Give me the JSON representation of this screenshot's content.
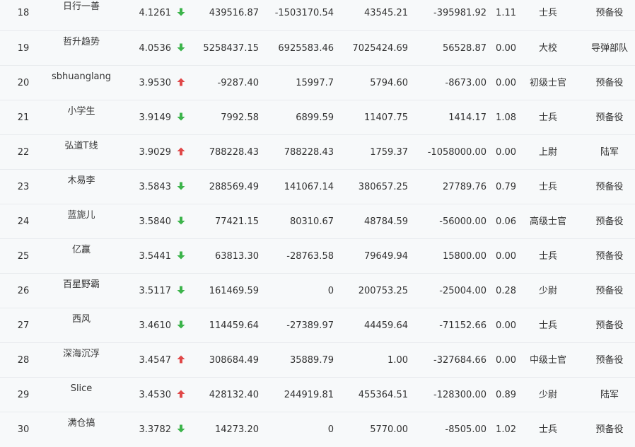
{
  "colors": {
    "up_arrow": "#e04848",
    "down_arrow": "#3cb44b",
    "text": "#333333",
    "background": "#f7f9fa"
  },
  "rows": [
    {
      "rank": "18",
      "name": "日行一善",
      "score": "4.1261",
      "trend": "down",
      "v1": "439516.87",
      "v2": "-1503170.54",
      "v3": "43545.21",
      "v4": "-395981.92",
      "ratio": "1.11",
      "military_rank": "士兵",
      "branch": "预备役"
    },
    {
      "rank": "19",
      "name": "哲升趋势",
      "score": "4.0536",
      "trend": "down",
      "v1": "5258437.15",
      "v2": "6925583.46",
      "v3": "7025424.69",
      "v4": "56528.87",
      "ratio": "0.00",
      "military_rank": "大校",
      "branch": "导弹部队"
    },
    {
      "rank": "20",
      "name": "sbhuanglang",
      "score": "3.9530",
      "trend": "up",
      "v1": "-9287.40",
      "v2": "15997.7",
      "v3": "5794.60",
      "v4": "-8673.00",
      "ratio": "0.00",
      "military_rank": "初级士官",
      "branch": "预备役"
    },
    {
      "rank": "21",
      "name": "小学生",
      "score": "3.9149",
      "trend": "down",
      "v1": "7992.58",
      "v2": "6899.59",
      "v3": "11407.75",
      "v4": "1414.17",
      "ratio": "1.08",
      "military_rank": "士兵",
      "branch": "预备役"
    },
    {
      "rank": "22",
      "name": "弘道T线",
      "score": "3.9029",
      "trend": "up",
      "v1": "788228.43",
      "v2": "788228.43",
      "v3": "1759.37",
      "v4": "-1058000.00",
      "ratio": "0.00",
      "military_rank": "上尉",
      "branch": "陆军"
    },
    {
      "rank": "23",
      "name": "木易李",
      "score": "3.5843",
      "trend": "down",
      "v1": "288569.49",
      "v2": "141067.14",
      "v3": "380657.25",
      "v4": "27789.76",
      "ratio": "0.79",
      "military_rank": "士兵",
      "branch": "预备役"
    },
    {
      "rank": "24",
      "name": "蓝旎儿",
      "score": "3.5840",
      "trend": "down",
      "v1": "77421.15",
      "v2": "80310.67",
      "v3": "48784.59",
      "v4": "-56000.00",
      "ratio": "0.06",
      "military_rank": "高级士官",
      "branch": "预备役"
    },
    {
      "rank": "25",
      "name": "亿赢",
      "score": "3.5441",
      "trend": "down",
      "v1": "63813.30",
      "v2": "-28763.58",
      "v3": "79649.94",
      "v4": "15800.00",
      "ratio": "0.00",
      "military_rank": "士兵",
      "branch": "预备役"
    },
    {
      "rank": "26",
      "name": "百星野霸",
      "score": "3.5117",
      "trend": "down",
      "v1": "161469.59",
      "v2": "0",
      "v3": "200753.25",
      "v4": "-25004.00",
      "ratio": "0.28",
      "military_rank": "少尉",
      "branch": "预备役"
    },
    {
      "rank": "27",
      "name": "西风",
      "score": "3.4610",
      "trend": "down",
      "v1": "114459.64",
      "v2": "-27389.97",
      "v3": "44459.64",
      "v4": "-71152.66",
      "ratio": "0.00",
      "military_rank": "士兵",
      "branch": "预备役"
    },
    {
      "rank": "28",
      "name": "深海沉浮",
      "score": "3.4547",
      "trend": "up",
      "v1": "308684.49",
      "v2": "35889.79",
      "v3": "1.00",
      "v4": "-327684.66",
      "ratio": "0.00",
      "military_rank": "中级士官",
      "branch": "预备役"
    },
    {
      "rank": "29",
      "name": "Slice",
      "score": "3.4530",
      "trend": "up",
      "v1": "428132.40",
      "v2": "244919.81",
      "v3": "455364.51",
      "v4": "-128300.00",
      "ratio": "0.89",
      "military_rank": "少尉",
      "branch": "陆军"
    },
    {
      "rank": "30",
      "name": "满仓搞",
      "score": "3.3782",
      "trend": "down",
      "v1": "14273.20",
      "v2": "0",
      "v3": "5770.00",
      "v4": "-8505.00",
      "ratio": "1.02",
      "military_rank": "士兵",
      "branch": "预备役"
    }
  ]
}
